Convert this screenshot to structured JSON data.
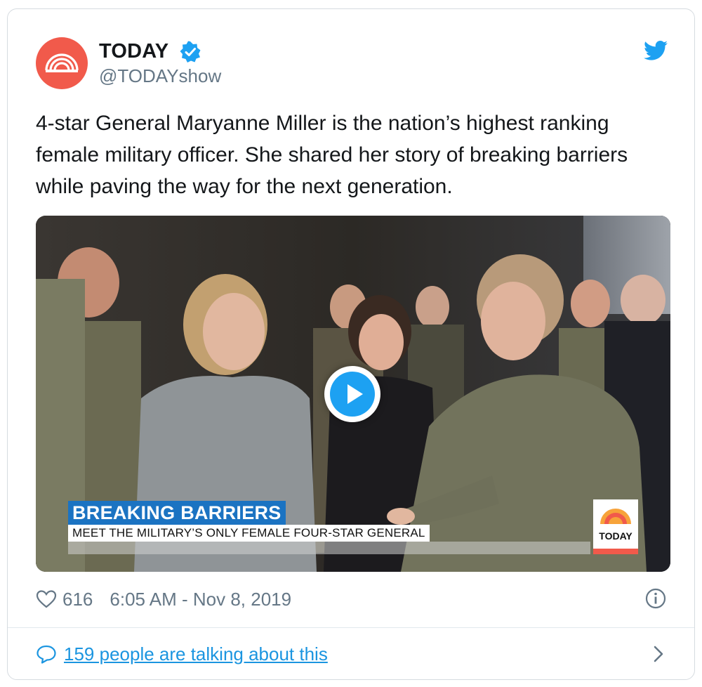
{
  "account": {
    "name": "TODAY",
    "handle": "@TODAYshow"
  },
  "tweet": {
    "text": "4-star General Maryanne Miller is the nation’s highest ranking female military officer. She shared her story of breaking barriers while paving the way for the next generation."
  },
  "media": {
    "banner_title": "BREAKING BARRIERS",
    "banner_subtitle": "MEET THE MILITARY’S ONLY FEMALE FOUR-STAR GENERAL",
    "logo_text": "TODAY"
  },
  "meta": {
    "likes": "616",
    "timestamp": "6:05 AM - Nov 8, 2019"
  },
  "conversation": {
    "link_text": "159 people are talking about this"
  },
  "icons": {
    "avatar": "today-logo-icon",
    "verified": "verified-badge-icon",
    "brand": "twitter-bird-icon",
    "play": "play-icon",
    "like": "heart-icon",
    "info": "info-icon",
    "reply": "speech-bubble-icon",
    "more": "chevron-right-icon"
  },
  "colors": {
    "brand_blue": "#1da1f2",
    "today_orange": "#f15a4b",
    "banner_blue": "#1b73c2",
    "link_blue": "#1b95e0",
    "muted": "#657786"
  }
}
